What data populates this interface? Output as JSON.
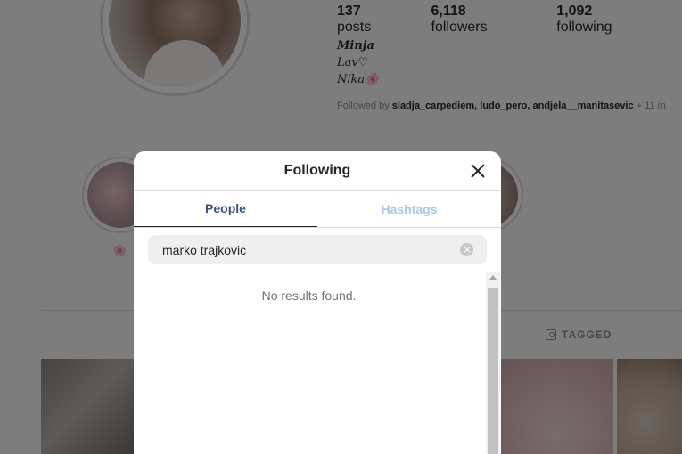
{
  "profile": {
    "stats": [
      {
        "value": "137",
        "label": "posts"
      },
      {
        "value": "6,118",
        "label": "followers"
      },
      {
        "value": "1,092",
        "label": "following"
      }
    ],
    "bio": {
      "name": "𝑴𝒊𝒏𝒋𝒂",
      "line1": "𝐿𝑎𝑣♡",
      "line2": "𝑁𝑖𝑘𝑎🌸"
    },
    "followed_by_prefix": "Followed by",
    "followed_by_users": "sladja_carpediem, ludo_pero, andjela__manitasevic",
    "followed_by_more": "+ 11 m",
    "highlight_flower": "🌸",
    "tagged_tab_label": "TAGGED"
  },
  "modal": {
    "title": "Following",
    "tabs": [
      {
        "label": "People",
        "active": true
      },
      {
        "label": "Hashtags",
        "active": false
      }
    ],
    "search": {
      "value": "marko trajkovic",
      "placeholder": "Search"
    },
    "empty_message": "No results found."
  },
  "colors": {
    "active_tab": "#385185",
    "inactive_tab": "#a8c7e8",
    "overlay": "rgba(0,0,0,0.5)"
  }
}
